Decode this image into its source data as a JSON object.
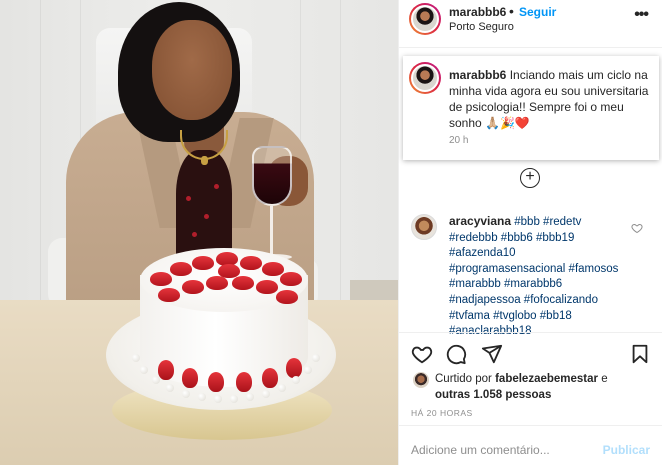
{
  "post": {
    "image_alt": "Foto de uma mulher sentada atrás de um bolo com morangos e segurando uma taça de vinho",
    "header": {
      "username": "marabbb6",
      "separator": "•",
      "follow_label": "Seguir",
      "location": "Porto Seguro",
      "more_icon": "more-options-icon"
    },
    "caption": {
      "username": "marabbb6",
      "text": "Inciando mais um ciclo na minha vida agora eu sou universitaria de psicologia!! Sempre foi o meu sonho 🙏🏼🎉❤️",
      "time": "20 h"
    },
    "load_more_icon": "plus-circle-icon",
    "comments": [
      {
        "username": "aracyviana",
        "text": "#bbb #redetv #redebbb #bbb6 #bbb19 #afazenda10 #programasensacional #famosos #marabbb #marabbb6 #nadjapessoa #fofocalizando #tvfama #tvglobo #bb18 #anaclarabbb18",
        "like_icon": "heart-outline-icon"
      }
    ],
    "actions": {
      "like_icon": "heart-outline-icon",
      "comment_icon": "comment-bubble-icon",
      "share_icon": "paper-plane-icon",
      "save_icon": "bookmark-icon"
    },
    "likes": {
      "prefix": "Curtido por",
      "user": "fabelezaebemestar",
      "joiner": "e",
      "others": "outras 1.058 pessoas"
    },
    "timestamp": "HÁ 20 HORAS",
    "add_comment": {
      "placeholder": "Adicione um comentário...",
      "publish_label": "Publicar"
    },
    "colors": {
      "link_blue": "#0095f6",
      "publish_disabled": "#b2dffc",
      "hashtag": "#00376b",
      "muted": "#8e8e8e"
    }
  }
}
